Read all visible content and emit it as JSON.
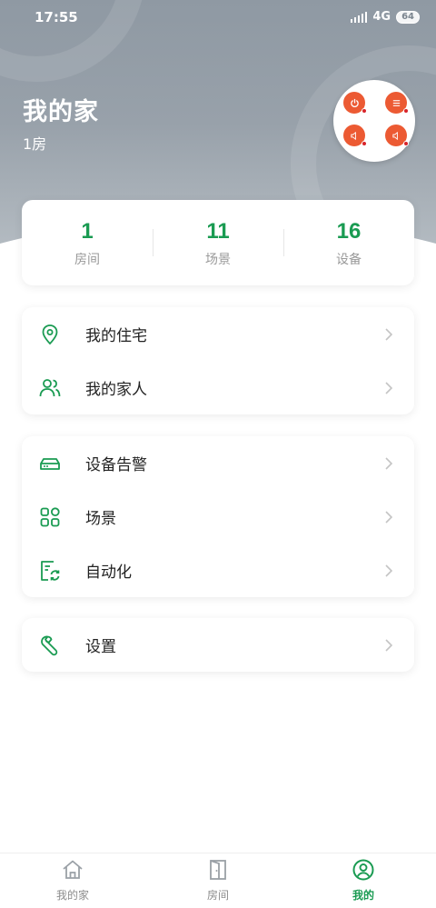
{
  "status_bar": {
    "time": "17:55",
    "network": "4G",
    "battery": "64"
  },
  "header": {
    "title": "我的家",
    "subtitle": "1房"
  },
  "stats": [
    {
      "value": "1",
      "label": "房间"
    },
    {
      "value": "11",
      "label": "场景"
    },
    {
      "value": "16",
      "label": "设备"
    }
  ],
  "menu_group_1": [
    {
      "label": "我的住宅",
      "icon": "location-pin-icon"
    },
    {
      "label": "我的家人",
      "icon": "family-icon"
    }
  ],
  "menu_group_2": [
    {
      "label": "设备告警",
      "icon": "device-alarm-icon"
    },
    {
      "label": "场景",
      "icon": "scene-grid-icon"
    },
    {
      "label": "自动化",
      "icon": "automation-icon"
    }
  ],
  "menu_group_3": [
    {
      "label": "设置",
      "icon": "wrench-icon"
    }
  ],
  "tabs": [
    {
      "label": "我的家",
      "icon": "home-icon",
      "active": false
    },
    {
      "label": "房间",
      "icon": "door-icon",
      "active": false
    },
    {
      "label": "我的",
      "icon": "profile-icon",
      "active": true
    }
  ],
  "colors": {
    "accent": "#1a9b52",
    "panel_button": "#ec5a33",
    "header_gray": "#98a1aa"
  }
}
